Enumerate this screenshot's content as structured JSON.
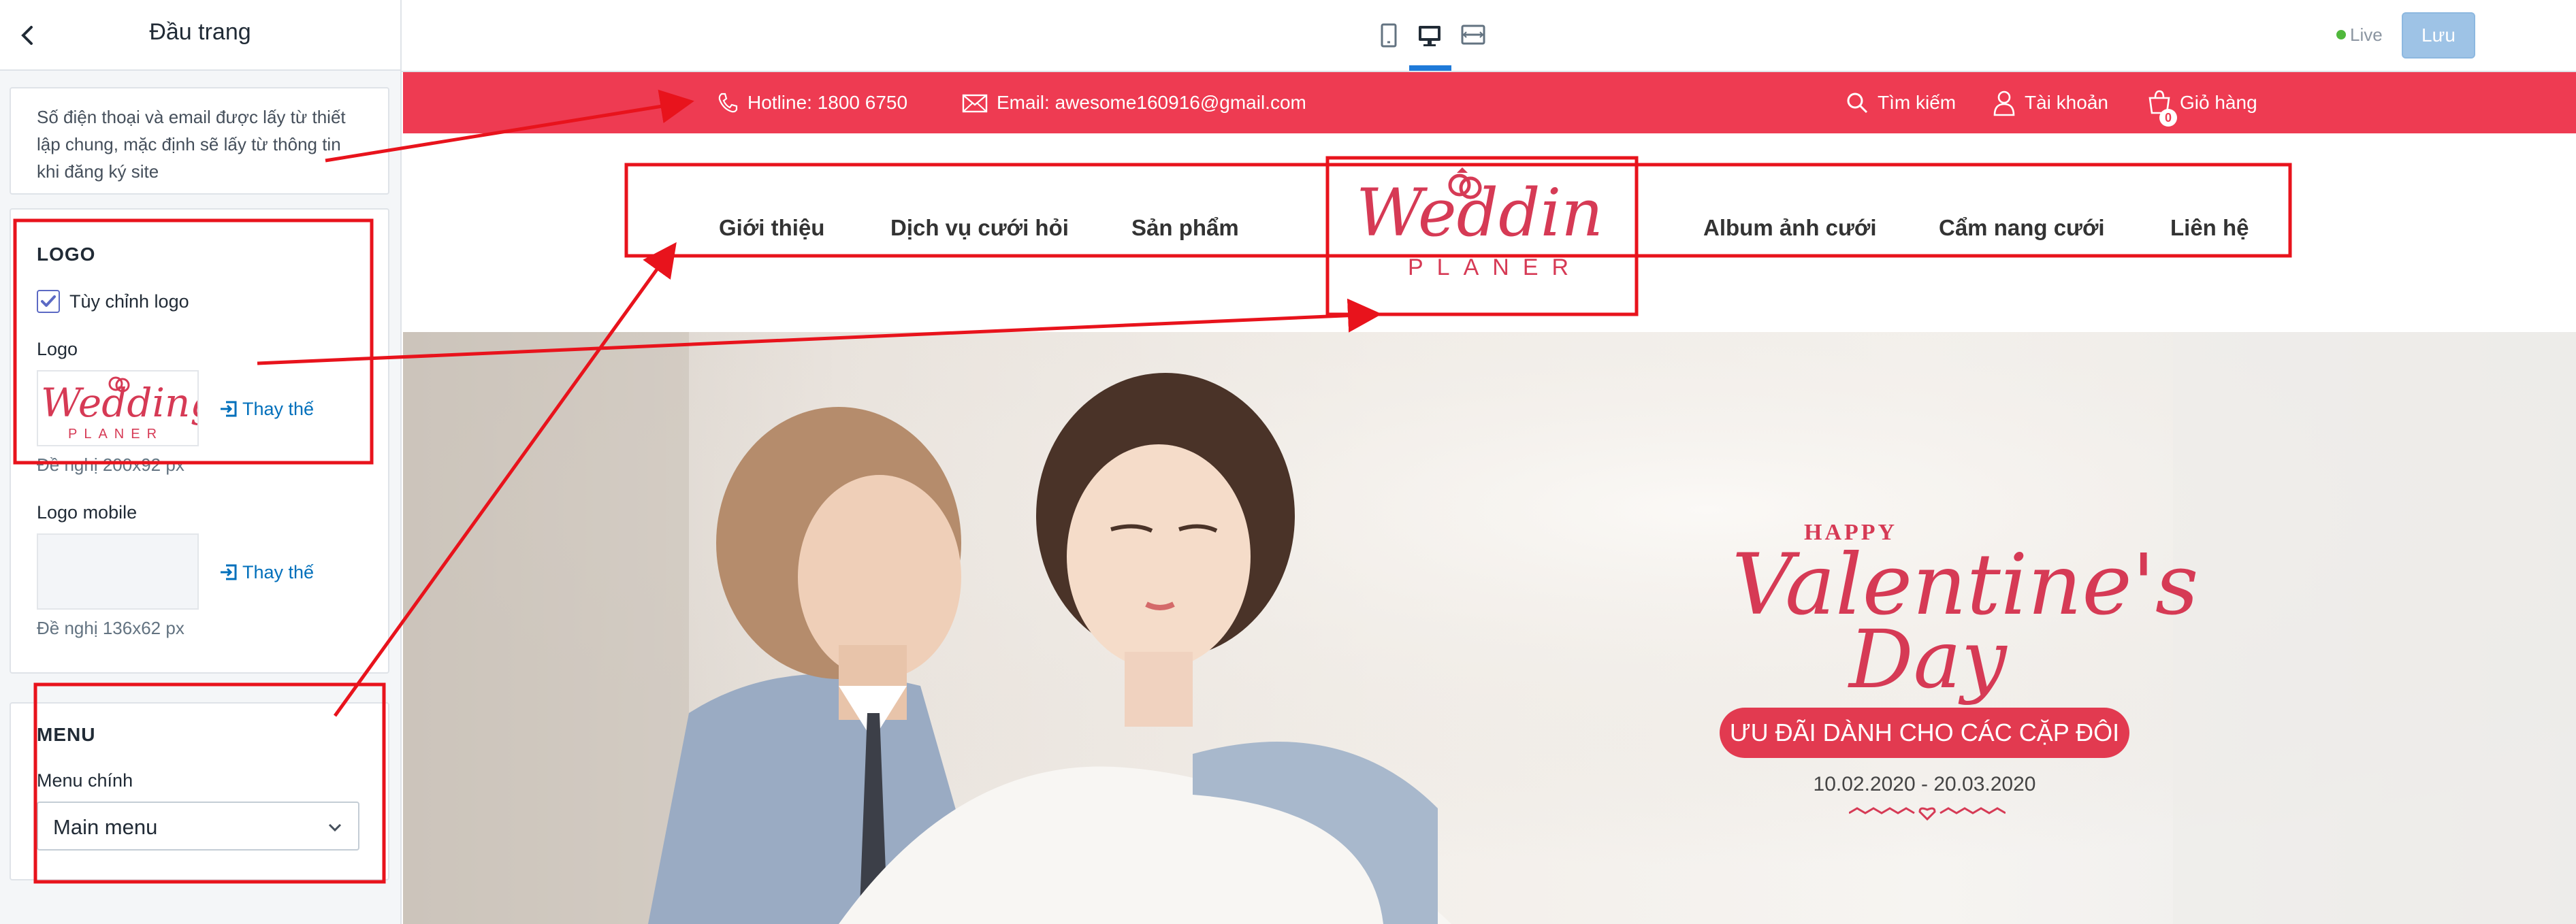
{
  "sidebar": {
    "title": "Đầu trang",
    "note": "Số điện thoại và email được lấy từ thiết lập chung, mặc định sẽ lấy từ thông tin khi đăng ký site",
    "logo_section": {
      "title": "LOGO",
      "custom_logo_label": "Tùy chỉnh logo",
      "custom_logo_checked": true,
      "logo_label": "Logo",
      "replace_label": "Thay thế",
      "logo_hint": "Đề nghị 200x92 px",
      "logo_mobile_label": "Logo mobile",
      "logo_mobile_replace_label": "Thay thế",
      "logo_mobile_hint": "Đề nghị 136x62 px"
    },
    "menu_section": {
      "title": "MENU",
      "main_menu_label": "Menu chính",
      "main_menu_value": "Main menu"
    }
  },
  "toolbar": {
    "active_device": "desktop",
    "live_label": "Live",
    "save_label": "Lưu"
  },
  "preview": {
    "topbar": {
      "hotline": "Hotline: 1800 6750",
      "email": "Email: awesome160916@gmail.com",
      "search": "Tìm kiếm",
      "account": "Tài khoản",
      "cart": "Giỏ hàng",
      "cart_count": "0",
      "color": "#ee3b52"
    },
    "logo": {
      "script": "Wedding",
      "sub": "PLANER"
    },
    "nav": [
      "Giới thiệu",
      "Dịch vụ cưới hỏi",
      "Sản phẩm",
      "Album ảnh cưới",
      "Cẩm nang cưới",
      "Liên hệ"
    ],
    "hero": {
      "happy": "HAPPY",
      "valentine": "Valentine's",
      "day": "Day",
      "badge": "ƯU ĐÃI DÀNH CHO CÁC CẶP ĐÔI",
      "dates": "10.02.2020 - 20.03.2020"
    }
  },
  "colors": {
    "accent": "#ee3b52",
    "annotation": "#e8131c",
    "link": "#006fbb",
    "save_button": "#9ec3e6"
  }
}
